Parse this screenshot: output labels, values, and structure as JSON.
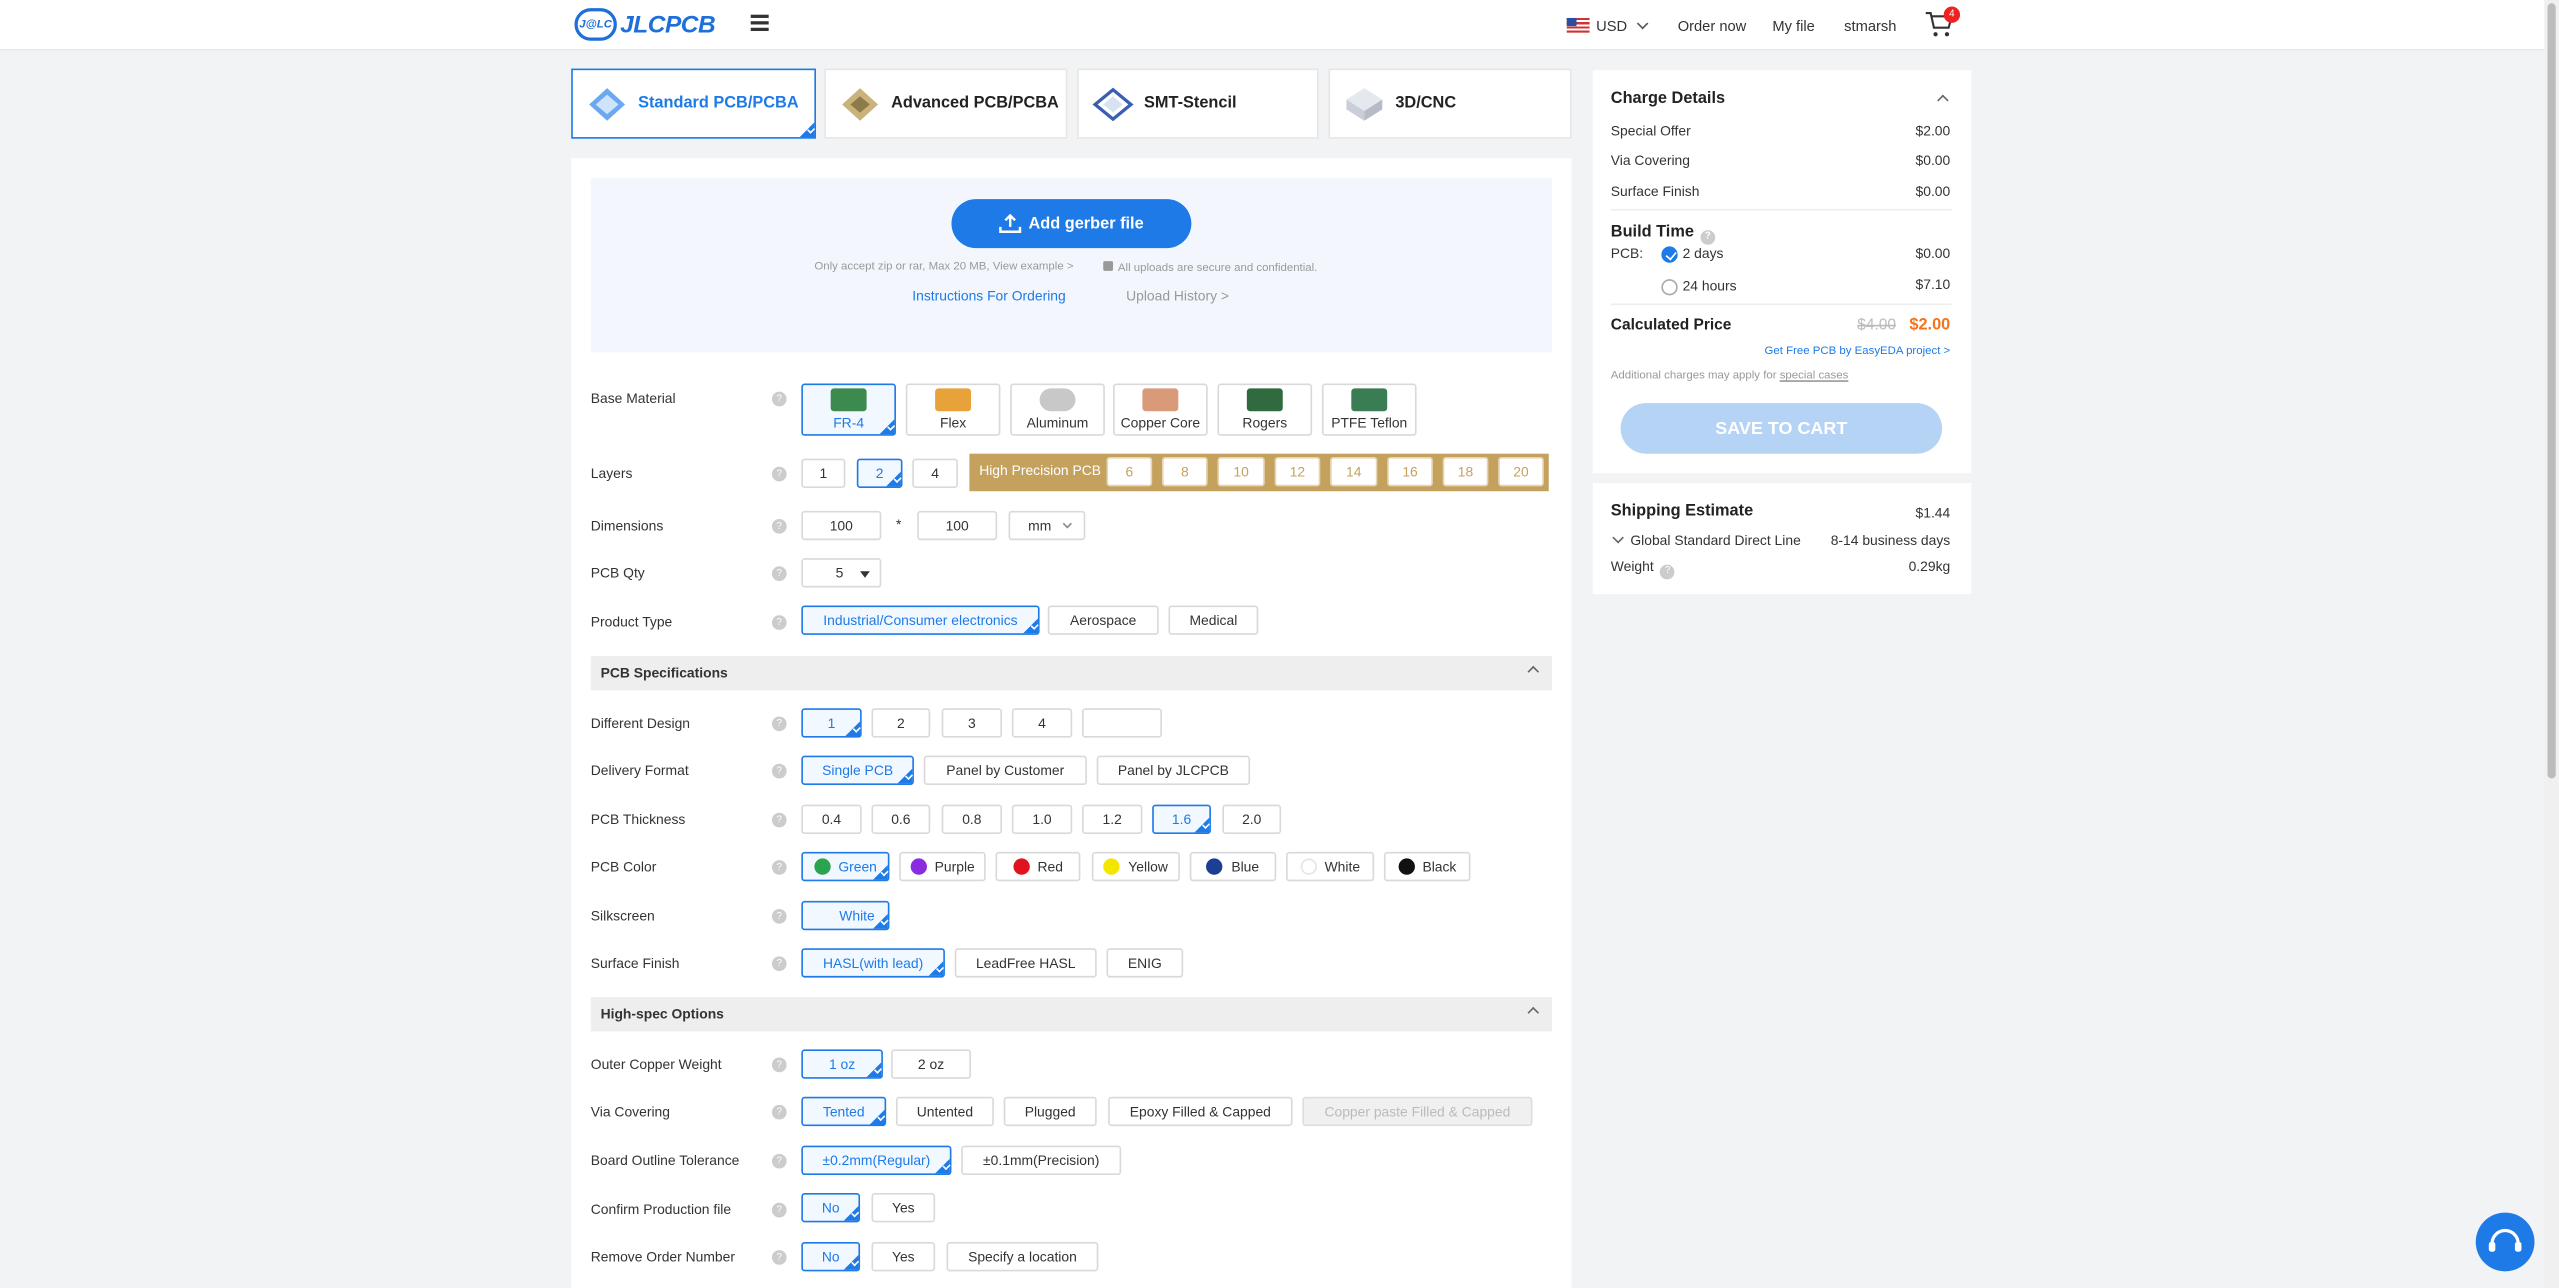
{
  "header": {
    "logo_badge": "J@LC",
    "logo_text": "JLCPCB",
    "currency": "USD",
    "order_now": "Order now",
    "my_file": "My file",
    "username": "stmarsh",
    "cart_count": "4"
  },
  "tabs": [
    {
      "label": "Standard PCB/PCBA",
      "active": true
    },
    {
      "label": "Advanced PCB/PCBA",
      "active": false
    },
    {
      "label": "SMT-Stencil",
      "active": false
    },
    {
      "label": "3D/CNC",
      "active": false
    }
  ],
  "upload": {
    "button": "Add gerber file",
    "note": "Only accept zip or rar, Max 20 MB, View example >",
    "secure": "All uploads are secure and confidential.",
    "instructions": "Instructions For Ordering",
    "history": "Upload History >"
  },
  "form": {
    "base_material": {
      "label": "Base Material",
      "options": [
        "FR-4",
        "Flex",
        "Aluminum",
        "Copper Core",
        "Rogers",
        "PTFE Teflon"
      ],
      "selected": "FR-4"
    },
    "layers": {
      "label": "Layers",
      "options": [
        "1",
        "2",
        "4"
      ],
      "selected": "2",
      "high_precision_label": "High Precision PCB",
      "high_precision_options": [
        "6",
        "8",
        "10",
        "12",
        "14",
        "16",
        "18",
        "20"
      ]
    },
    "dimensions": {
      "label": "Dimensions",
      "width": "100",
      "height": "100",
      "separator": "*",
      "unit": "mm"
    },
    "pcb_qty": {
      "label": "PCB Qty",
      "value": "5"
    },
    "product_type": {
      "label": "Product Type",
      "options": [
        "Industrial/Consumer electronics",
        "Aerospace",
        "Medical"
      ],
      "selected": "Industrial/Consumer electronics"
    },
    "pcb_specifications": {
      "title": "PCB Specifications"
    },
    "different_design": {
      "label": "Different Design",
      "options": [
        "1",
        "2",
        "3",
        "4"
      ],
      "selected": "1"
    },
    "delivery_format": {
      "label": "Delivery Format",
      "options": [
        "Single PCB",
        "Panel by Customer",
        "Panel by JLCPCB"
      ],
      "selected": "Single PCB"
    },
    "pcb_thickness": {
      "label": "PCB Thickness",
      "options": [
        "0.4",
        "0.6",
        "0.8",
        "1.0",
        "1.2",
        "1.6",
        "2.0"
      ],
      "selected": "1.6"
    },
    "pcb_color": {
      "label": "PCB Color",
      "options": [
        {
          "name": "Green",
          "color": "#2aa44f"
        },
        {
          "name": "Purple",
          "color": "#8a2be2"
        },
        {
          "name": "Red",
          "color": "#e0141e"
        },
        {
          "name": "Yellow",
          "color": "#f5e600"
        },
        {
          "name": "Blue",
          "color": "#1c3f94"
        },
        {
          "name": "White",
          "color": "#ffffff"
        },
        {
          "name": "Black",
          "color": "#111111"
        }
      ],
      "selected": "Green"
    },
    "silkscreen": {
      "label": "Silkscreen",
      "value": "White"
    },
    "surface_finish": {
      "label": "Surface Finish",
      "options": [
        "HASL(with lead)",
        "LeadFree HASL",
        "ENIG"
      ],
      "selected": "HASL(with lead)"
    },
    "high_spec": {
      "title": "High-spec Options"
    },
    "outer_copper": {
      "label": "Outer Copper Weight",
      "options": [
        "1 oz",
        "2 oz"
      ],
      "selected": "1 oz"
    },
    "via_covering": {
      "label": "Via Covering",
      "options": [
        "Tented",
        "Untented",
        "Plugged",
        "Epoxy Filled & Capped",
        "Copper paste Filled & Capped"
      ],
      "selected": "Tented"
    },
    "outline_tolerance": {
      "label": "Board Outline Tolerance",
      "options": [
        "±0.2mm(Regular)",
        "±0.1mm(Precision)"
      ],
      "selected": "±0.2mm(Regular)"
    },
    "confirm_production": {
      "label": "Confirm Production file",
      "options": [
        "No",
        "Yes"
      ],
      "selected": "No"
    },
    "remove_order_number": {
      "label": "Remove Order Number",
      "options": [
        "No",
        "Yes",
        "Specify a location"
      ],
      "selected": "No"
    }
  },
  "charges": {
    "title": "Charge Details",
    "items": [
      {
        "label": "Special Offer",
        "value": "$2.00"
      },
      {
        "label": "Via Covering",
        "value": "$0.00"
      },
      {
        "label": "Surface Finish",
        "value": "$0.00"
      }
    ],
    "build_time_title": "Build Time",
    "pcb_label": "PCB:",
    "build_options": [
      {
        "label": "2 days",
        "value": "$0.00",
        "selected": true
      },
      {
        "label": "24 hours",
        "value": "$7.10",
        "selected": false
      }
    ],
    "calculated_label": "Calculated Price",
    "old_price": "$4.00",
    "price": "$2.00",
    "easyeda_link": "Get Free PCB by EasyEDA project >",
    "additional_note": "Additional charges may apply for",
    "special_cases": "special cases",
    "save_button": "SAVE TO CART"
  },
  "shipping": {
    "title": "Shipping Estimate",
    "cost": "$1.44",
    "method": "Global Standard Direct Line",
    "days": "8-14 business days",
    "weight_label": "Weight",
    "weight": "0.29kg"
  },
  "colors": {
    "accent": "#1e7ae6",
    "price": "#f5731f",
    "high_precision": "#c4a25e"
  }
}
